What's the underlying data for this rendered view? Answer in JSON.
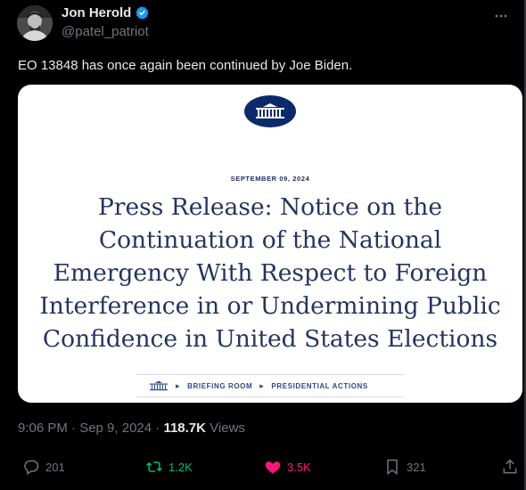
{
  "post": {
    "author_name": "Jon Herold",
    "author_handle": "@patel_patriot",
    "text": "EO 13848 has once again been continued by Joe Biden.",
    "timestamp": "9:06 PM · Sep 9, 2024 ·",
    "views_count": "118.7K",
    "views_label": "Views"
  },
  "card": {
    "date": "SEPTEMBER 09, 2024",
    "title_lines": [
      "Press Release: Notice on the",
      "Continuation of the National",
      "Emergency With Respect to Foreign",
      "Interference in or Undermining Public",
      "Confidence in United States Elections"
    ],
    "breadcrumb": [
      "BRIEFING ROOM",
      "PRESIDENTIAL ACTIONS"
    ]
  },
  "actions": {
    "replies": "201",
    "reposts": "1.2K",
    "likes": "3.5K",
    "bookmarks": "321"
  },
  "colors": {
    "repost_active": "#00ba7c",
    "like_active": "#f91880",
    "verified": "#1d9bf0",
    "wh_navy": "#0c2a6b"
  },
  "icons": [
    "verified-badge-icon",
    "more-icon",
    "white-house-logo",
    "reply-icon",
    "repost-icon",
    "like-icon",
    "bookmark-icon",
    "share-icon"
  ]
}
